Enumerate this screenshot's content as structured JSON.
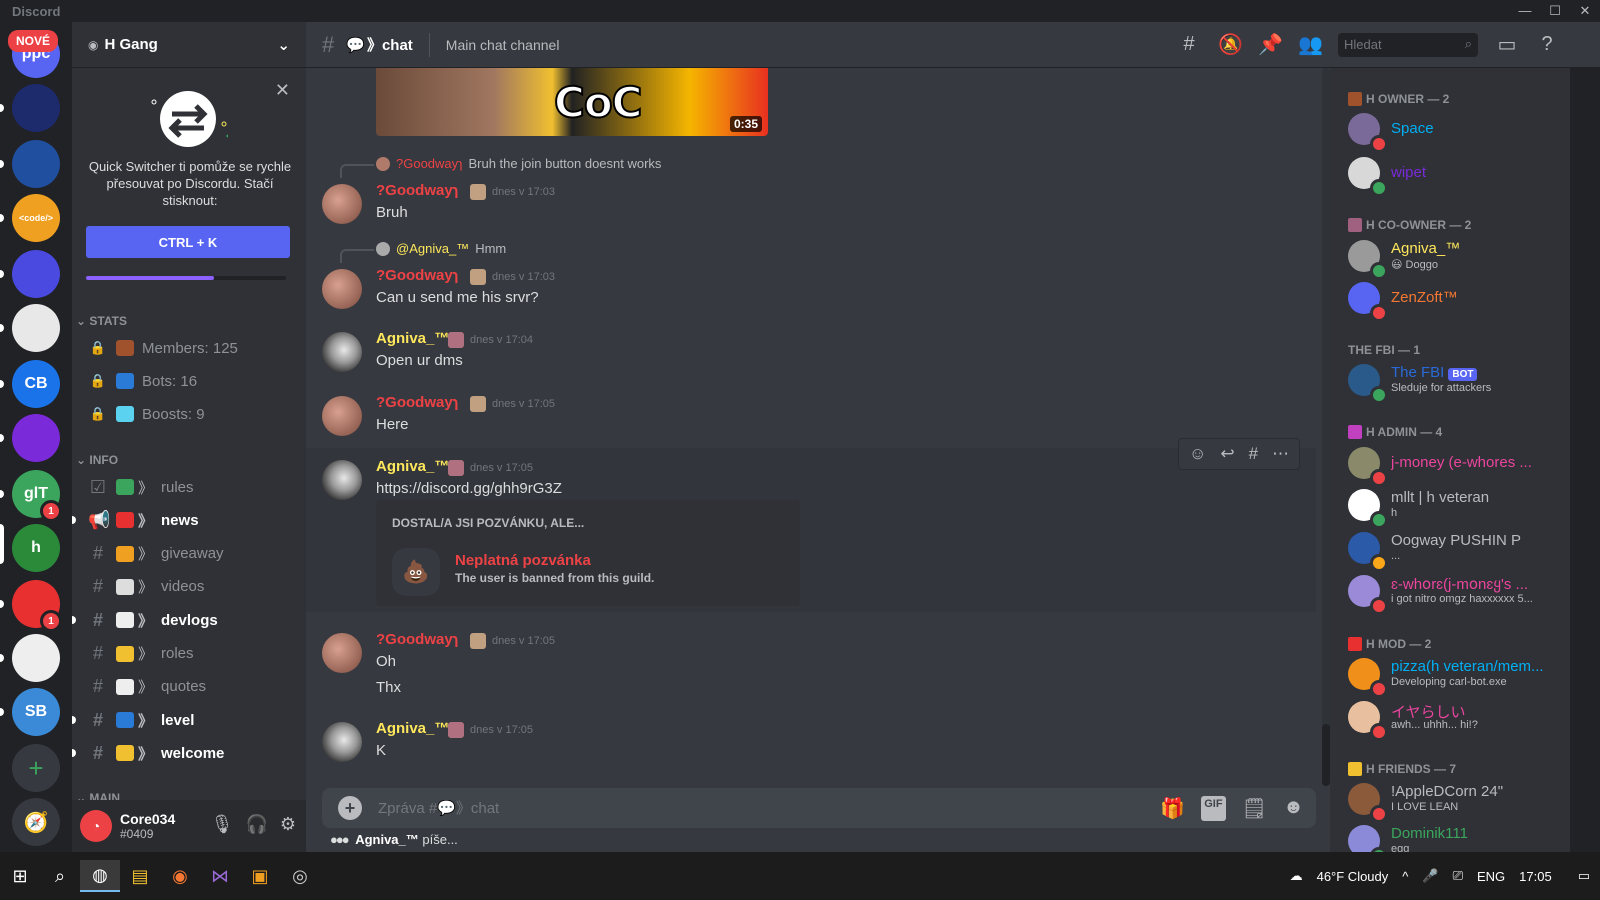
{
  "app": {
    "title": "Discord",
    "nove_badge": "NOVÉ"
  },
  "window": {
    "minimize": "—",
    "maximize": "☐",
    "close": "✕"
  },
  "servers": [
    {
      "initials": "ppc",
      "color": "#5865f2"
    },
    {
      "initials": "",
      "color": "#1d2a6b"
    },
    {
      "initials": "",
      "color": "#1f4f9e"
    },
    {
      "initials": "<code/>",
      "color": "#f0a020"
    },
    {
      "initials": "",
      "color": "#4a4ae0"
    },
    {
      "initials": "",
      "color": "#e8e8e8"
    },
    {
      "initials": "CB",
      "color": "#1a73e8"
    },
    {
      "initials": "",
      "color": "#7a2ad8"
    },
    {
      "initials": "glT",
      "color": "#3ba55d",
      "badge": "1"
    },
    {
      "initials": "h",
      "color": "#2a8a3a"
    },
    {
      "initials": "",
      "color": "#e83030",
      "badge": "1"
    },
    {
      "initials": "",
      "color": "#eeeeee"
    },
    {
      "initials": "SB",
      "color": "#3a8ad8"
    }
  ],
  "guild": {
    "name": "H Gang"
  },
  "quick_switcher": {
    "text": "Quick Switcher ti pomůže se rychle přesouvat po Discordu. Stačí stisknout:",
    "shortcut": "CTRL + K",
    "progress": 0.64
  },
  "categories": {
    "stats": "STATS",
    "info": "INFO",
    "main": "MAIN"
  },
  "stats_channels": [
    {
      "name": "Members: 125",
      "emoji_color": "#a0522d"
    },
    {
      "name": "Bots: 16",
      "emoji_color": "#2a7ad8"
    },
    {
      "name": "Boosts: 9",
      "emoji_color": "#5ad2f0"
    }
  ],
  "info_channels": [
    {
      "name": "rules",
      "unread": false,
      "emoji_color": "#3ba55d"
    },
    {
      "name": "news",
      "unread": true,
      "emoji_color": "#e83030"
    },
    {
      "name": "giveaway",
      "unread": false,
      "emoji_color": "#f0a020"
    },
    {
      "name": "videos",
      "unread": false,
      "emoji_color": "#dddddd"
    },
    {
      "name": "devlogs",
      "unread": true,
      "emoji_color": "#eeeeee"
    },
    {
      "name": "roles",
      "unread": false,
      "emoji_color": "#f0c030"
    },
    {
      "name": "quotes",
      "unread": false,
      "emoji_color": "#eeeeee"
    },
    {
      "name": "level",
      "unread": true,
      "emoji_color": "#2a7ad8"
    },
    {
      "name": "welcome",
      "unread": true,
      "emoji_color": "#f0c030"
    }
  ],
  "user": {
    "name": "Core034",
    "tag": "#0409"
  },
  "channel": {
    "name": "chat",
    "topic": "Main chat channel"
  },
  "search": {
    "placeholder": "Hledat"
  },
  "video": {
    "title_text": "CoC",
    "duration": "0:35"
  },
  "messages": [
    {
      "reply_author": "?Goodwayɿ",
      "reply_text": "Bruh the join button doesnt works",
      "author": "?Goodwayɿ",
      "time": "dnes v 17:03",
      "lines": [
        "Bruh"
      ]
    },
    {
      "reply_author": "@Agniva_™",
      "reply_text": "Hmm",
      "author": "?Goodwayɿ",
      "time": "dnes v 17:03",
      "lines": [
        "Can u send me his srvr?"
      ]
    },
    {
      "author": "Agniva_™",
      "time": "dnes v 17:04",
      "lines": [
        "Open ur dms"
      ]
    },
    {
      "author": "?Goodwayɿ",
      "time": "dnes v 17:05",
      "lines": [
        "Here"
      ]
    },
    {
      "author": "Agniva_™",
      "time": "dnes v 17:05",
      "lines": [
        "https://discord.gg/ghh9rG3Z"
      ]
    },
    {
      "author": "?Goodwayɿ",
      "time": "dnes v 17:05",
      "lines": [
        "Oh",
        "Thx"
      ]
    },
    {
      "author": "Agniva_™",
      "time": "dnes v 17:05",
      "lines": [
        "K"
      ]
    }
  ],
  "invite": {
    "caption": "DOSTAL/A JSI POZVÁNKU, ALE...",
    "title": "Neplatná pozvánka",
    "subtitle": "The user is banned from this guild."
  },
  "composer": {
    "placeholder": "Zpráva #💬》chat",
    "gif_label": "GIF"
  },
  "typing": {
    "user": "Agniva_™",
    "text": "píše..."
  },
  "member_groups": [
    {
      "title": "H OWNER — 2",
      "icon_color": "#a0522d"
    },
    {
      "title": "H CO-OWNER — 2",
      "icon_color": "#a06080"
    },
    {
      "title": "THE FBI — 1",
      "icon_color": ""
    },
    {
      "title": "H ADMIN — 4",
      "icon_color": "#c040c0"
    },
    {
      "title": "H MOD — 2",
      "icon_color": "#e83030"
    },
    {
      "title": "H FRIENDS — 7",
      "icon_color": "#f0c030"
    }
  ],
  "members": [
    {
      "name": "Space",
      "activity": "",
      "color": "#00aff4",
      "status": "dnd",
      "av": "#7a6a9a"
    },
    {
      "name": "wipet",
      "activity": "",
      "color": "#7a2ad8",
      "status": "online",
      "av": "#d8d8d8"
    },
    {
      "name": "Agniva_™",
      "activity": "😃 Doggo",
      "color": "#fee75c",
      "status": "online",
      "av": "#9a9a9a"
    },
    {
      "name": "ZenZoft™",
      "activity": "",
      "color": "#f57731",
      "status": "dnd",
      "av": "#5865f2"
    },
    {
      "name": "The FBI",
      "activity": "Sleduje for attackers",
      "color": "#2a6ad8",
      "status": "online",
      "av": "#2a5a8a",
      "bot": "BOT"
    },
    {
      "name": "j-money (e-whores ...",
      "activity": "",
      "color": "#eb459e",
      "status": "dnd",
      "av": "#8a8a6a"
    },
    {
      "name": "mllt | h veteran",
      "activity": "h",
      "color": "#b9bbbe",
      "status": "online",
      "av": "#ffffff"
    },
    {
      "name": "Oogway PUSHIN P",
      "activity": "...",
      "color": "#b9bbbe",
      "status": "idle",
      "av": "#2a5aa8"
    },
    {
      "name": "ɛ-whօrɛ(j-mօnɛყ's ...",
      "activity": "i got nitro omgz haxxxxxx 5...",
      "color": "#eb459e",
      "status": "dnd",
      "av": "#9a8ad8"
    },
    {
      "name": "pizza(h veteran/mem...",
      "activity": "Developing carl-bot.exe",
      "color": "#00aff4",
      "status": "dnd",
      "av": "#f0901a"
    },
    {
      "name": "イヤらしい",
      "activity": "awh... uhhh... hi!?",
      "color": "#eb459e",
      "status": "dnd",
      "av": "#e8c0a0"
    },
    {
      "name": "!AppleDCorn 24\"",
      "activity": "I LOVE LEAN",
      "color": "#b9bbbe",
      "status": "dnd",
      "av": "#8a5a3a"
    },
    {
      "name": "Dominik111",
      "activity": "egg",
      "color": "#3ba55d",
      "status": "online",
      "av": "#8a8ad8"
    }
  ],
  "taskbar": {
    "weather": "46°F  Cloudy",
    "lang": "ENG",
    "time": "17:05"
  }
}
